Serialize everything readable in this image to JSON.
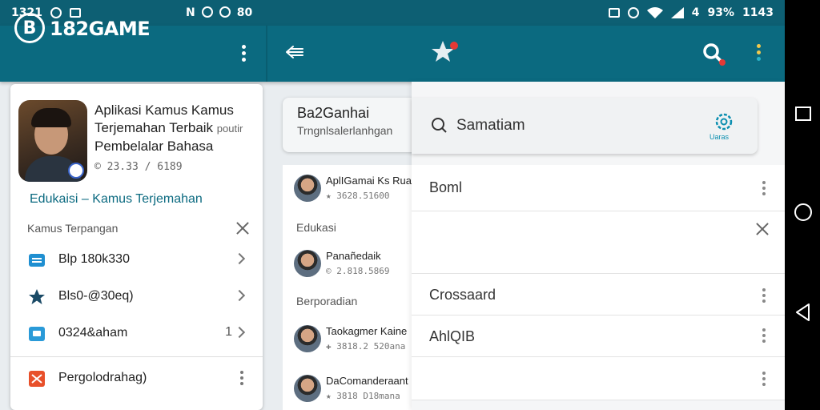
{
  "status_bar": {
    "time_left": "1321",
    "mid_text": "80",
    "battery": "93%",
    "time_right": "1143",
    "battery_prefix": "4"
  },
  "app_bar": {
    "logo_letter": "B",
    "title": "182GAME"
  },
  "left_card": {
    "title_line1": "Aplikasi Kamus Kamus",
    "title_line2": "Terjemahan Terbaik",
    "title_line2_suffix": "poutir",
    "title_line3": "Pembelalar Bahasa",
    "meta": "© 23.33 / 6189",
    "category": "Edukaisi – Kamus Terjemahan",
    "section_label": "Kamus Terpangan",
    "rows": [
      {
        "label": "Blp 180k330",
        "icon": "list-icon",
        "color": "#1f8fd1"
      },
      {
        "label": "Bls0-@30eq)",
        "icon": "star-icon",
        "color": "#1a4a66"
      },
      {
        "label": "0324&aham",
        "icon": "window-icon",
        "color": "#2a9ad8",
        "count": "1"
      },
      {
        "label": "Pergolodrahag)",
        "icon": "shuffle-icon",
        "color": "#e8502a"
      }
    ]
  },
  "middle": {
    "card_title": "Ba2Ganhai",
    "card_subtitle": "Trngnlsalerlanhgan",
    "items": [
      {
        "name": "AplIGamai Ks Ruai",
        "meta": "★ 3628.51600"
      },
      {
        "name": "Panañedaik",
        "meta": "© 2.818.5869"
      },
      {
        "name": "Taokagmer Kaine",
        "meta": "✚ 3818.2 520ana"
      },
      {
        "name": "DaComanderaant",
        "meta": "★ 3818 D18mana"
      }
    ],
    "section_edukasi": "Edukasi",
    "section_berporadian": "Berporadian"
  },
  "right_panel": {
    "search_placeholder": "Samatiam",
    "gear_label": "Uaras",
    "rows": [
      {
        "label": "Boml"
      },
      {
        "label": ""
      },
      {
        "label": "Crossaard"
      },
      {
        "label": "AhlQIB"
      },
      {
        "label": ""
      }
    ]
  },
  "colors": {
    "primary": "#0b6a80",
    "status_bar": "#0d5f73",
    "accent_red": "#e53935"
  }
}
